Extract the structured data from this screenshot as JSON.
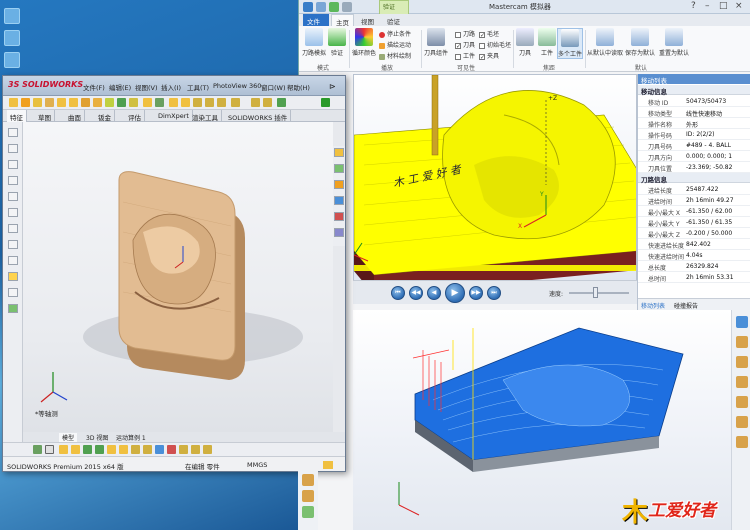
{
  "mastercam": {
    "title": "Mastercam 模拟器",
    "context_tab": "验证",
    "tabs": {
      "file": "文件",
      "home": "主页",
      "view": "视图",
      "verify": "验证"
    },
    "ribbon": {
      "toolpath_mode": "刀路模拟",
      "verify": "验证",
      "loop_color": "循环颜色",
      "stop_conditions": "停止条件",
      "drawing_mode": "描绘运动",
      "material_drawing": "材料绘制",
      "tool_assembly": "刀具组件",
      "cb_toolpath": "刀路",
      "cb_tool": "刀具",
      "cb_workpiece": "工件",
      "cb_blank": "毛坯",
      "cb_init_blank": "初始毛坯",
      "cb_holder": "夹具",
      "tool": "刀具",
      "workpiece": "工件",
      "multi_workpiece": "多个工件",
      "reset_from_default": "从默认中读取",
      "save_as_default": "保存为默认",
      "reset_to_default": "重置为默认",
      "group_mode": "模式",
      "group_playback": "播放",
      "group_visibility": "可见性",
      "group_focus": "焦距",
      "group_default": "默认"
    },
    "panel": {
      "title": "移动列表",
      "section_move": "移动信息",
      "rows_move": [
        {
          "k": "移动 ID",
          "v": "50473/50473"
        },
        {
          "k": "移动类型",
          "v": "线性快速移动"
        },
        {
          "k": "操作名称",
          "v": "外形"
        },
        {
          "k": "操作号码",
          "v": "ID: 2(2/2)"
        },
        {
          "k": "刀具号码",
          "v": "#489 - 4. BALL"
        },
        {
          "k": "刀具方向",
          "v": "0.000; 0.000; 1"
        },
        {
          "k": "刀具位置",
          "v": "-23.369; -50.82"
        }
      ],
      "section_toolpath": "刀路信息",
      "rows_toolpath": [
        {
          "k": "进给长度",
          "v": "25487.422"
        },
        {
          "k": "进给时间",
          "v": "2h 16min 49.27"
        },
        {
          "k": "最小/最大 X",
          "v": "-61.350 / 62.00"
        },
        {
          "k": "最小/最大 Y",
          "v": "-61.350 / 61.35"
        },
        {
          "k": "最小/最大 Z",
          "v": "-0.200 / 50.000"
        },
        {
          "k": "快速进给长度",
          "v": "842.402"
        },
        {
          "k": "快速进给时间",
          "v": "4.04s"
        },
        {
          "k": "总长度",
          "v": "26329.824"
        },
        {
          "k": "总时间",
          "v": "2h 16min 53.31"
        }
      ],
      "tab_moves": "移动列表",
      "tab_report": "碰撞报告"
    },
    "playback": {
      "speed_label": "速度:",
      "speed_level": 0.4
    },
    "axis_labels": {
      "x": "X",
      "y": "Y",
      "z": "+Z"
    }
  },
  "solidworks": {
    "logo": "3S SOLIDWORKS",
    "menus": [
      "文件(F)",
      "编辑(E)",
      "视图(V)",
      "插入(I)",
      "工具(T)",
      "PhotoView 360",
      "窗口(W)",
      "帮助(H)"
    ],
    "tabs": [
      "特征",
      "草图",
      "曲面",
      "钣金",
      "评估",
      "DimXpert",
      "渲染工具",
      "SOLIDWORKS 插件"
    ],
    "bottom_tabs": [
      "模型",
      "3D 视图",
      "运动算例 1"
    ],
    "view_label": "*等轴测",
    "status_product": "SOLIDWORKS Premium 2015 x64 版",
    "status_mode": "在编辑 零件",
    "status_units": "MMGS"
  },
  "watermark": {
    "mu": "木",
    "text": "工爱好者"
  },
  "colors": {
    "accent": "#2c72c7",
    "stock_yellow": "#ffff00",
    "toolpath_blue": "#1e6fe0",
    "wood": "#e2bc92"
  }
}
